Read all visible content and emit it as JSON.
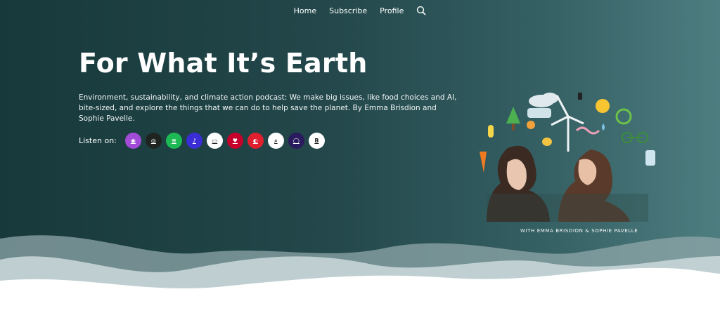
{
  "nav": {
    "items": [
      {
        "label": "Home"
      },
      {
        "label": "Subscribe"
      },
      {
        "label": "Profile"
      }
    ],
    "search_icon": "search-icon"
  },
  "hero": {
    "title": "For What It’s Earth",
    "description": "Environment, sustainability, and climate action podcast: We make big issues, like food choices and AI, bite-sized, and explore the things that we can do to help save the planet. By Emma Brisdion and Sophie Pavelle.",
    "listen_label": "Listen on:"
  },
  "platforms": [
    {
      "name": "apple-podcasts-icon",
      "color": "#a24bd6",
      "glyph": "◉"
    },
    {
      "name": "overcast-icon",
      "color": "#1f2421",
      "glyph": "◎"
    },
    {
      "name": "spotify-icon",
      "color": "#1db954",
      "glyph": "≋"
    },
    {
      "name": "amazon-music-icon",
      "color": "#3b2dd6",
      "glyph": "♪"
    },
    {
      "name": "pocket-casts-icon",
      "color": "#ffffff",
      "glyph": "▭"
    },
    {
      "name": "iheartradio-icon",
      "color": "#c6002b",
      "glyph": "♥"
    },
    {
      "name": "castbox-icon",
      "color": "#e0202f",
      "glyph": "◐"
    },
    {
      "name": "podcast-addict-icon",
      "color": "#ffffff",
      "glyph": "⌕"
    },
    {
      "name": "podbean-icon",
      "color": "#2a1a5e",
      "glyph": "◯"
    },
    {
      "name": "breaker-icon",
      "color": "#ffffff",
      "glyph": "B"
    }
  ],
  "artwork": {
    "caption": "WITH EMMA BRISDION & SOPHIE PAVELLE"
  }
}
